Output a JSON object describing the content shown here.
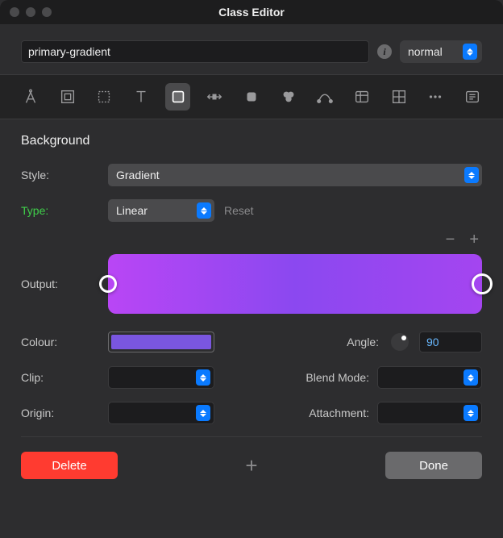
{
  "window": {
    "title": "Class Editor"
  },
  "header": {
    "class_name": "primary-gradient",
    "state": "normal"
  },
  "toolbar_icons": [
    "compass",
    "box-outer",
    "box-dashed",
    "text",
    "fill",
    "spacing",
    "rounded",
    "filters",
    "curve",
    "table",
    "grid",
    "more",
    "panel"
  ],
  "section": {
    "title": "Background"
  },
  "labels": {
    "style": "Style:",
    "type": "Type:",
    "output": "Output:",
    "colour": "Colour:",
    "angle": "Angle:",
    "clip": "Clip:",
    "blend": "Blend Mode:",
    "origin": "Origin:",
    "attachment": "Attachment:",
    "reset": "Reset"
  },
  "values": {
    "style": "Gradient",
    "type": "Linear",
    "angle": "90",
    "clip": "",
    "blend": "",
    "origin": "",
    "attachment": "",
    "colour": "#7a56e0",
    "gradient_from": "#b946f5",
    "gradient_to": "#a445f0"
  },
  "buttons": {
    "delete": "Delete",
    "done": "Done"
  }
}
